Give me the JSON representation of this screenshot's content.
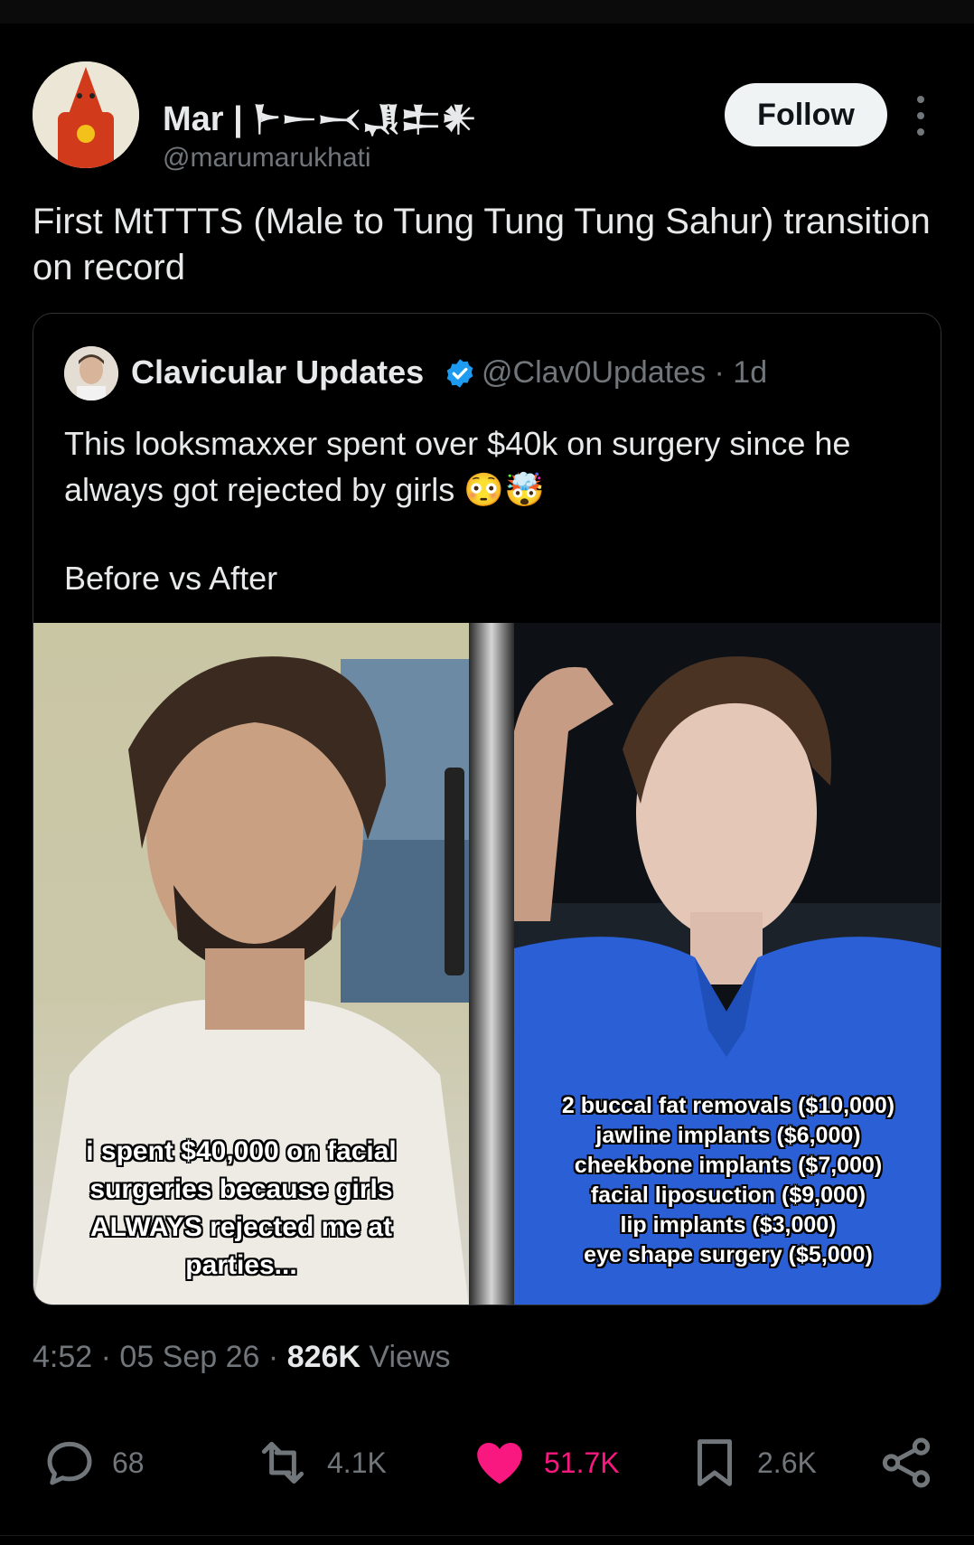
{
  "author": {
    "display_name": "Mar | 𒈨𒀸𒁁𒂗𒉺𒀭",
    "handle": "@marumarukhati",
    "follow_label": "Follow"
  },
  "tweet": {
    "text": "First MtTTTS (Male to Tung Tung Tung Sahur) transition on record"
  },
  "quote": {
    "name": "Clavicular Updates",
    "handle_time": "@Clav0Updates · 1d",
    "text": "This looksmaxxer spent over $40k on surgery since he always got rejected by girls 😳🤯",
    "text2": "Before vs After",
    "caption_left": "i spent $40,000 on facial surgeries because girls ALWAYS rejected me at parties...",
    "caption_right": [
      "2 buccal fat removals ($10,000)",
      "jawline implants ($6,000)",
      "cheekbone implants ($7,000)",
      "facial liposuction ($9,000)",
      "lip implants ($3,000)",
      "eye shape surgery ($5,000)"
    ]
  },
  "meta": {
    "time": "4:52",
    "date": "05 Sep 26",
    "views_count": "826K",
    "views_label": "Views"
  },
  "actions": {
    "replies": "68",
    "reposts": "4.1K",
    "likes": "51.7K",
    "bookmarks": "2.6K"
  },
  "colors": {
    "background": "#000000",
    "text": "#e7e9ea",
    "secondary": "#71767b",
    "like": "#f91880",
    "verified": "#1d9bf0",
    "shirt_blue": "#2a5fd6"
  }
}
